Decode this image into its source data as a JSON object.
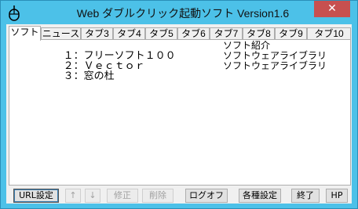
{
  "window": {
    "title": "Web ダブルクリック起動ソフト  Version1.6",
    "close_label": "✕"
  },
  "tabs": [
    {
      "label": "ソフト"
    },
    {
      "label": "ニュース"
    },
    {
      "label": "タブ3"
    },
    {
      "label": "タブ4"
    },
    {
      "label": "タブ5"
    },
    {
      "label": "タブ6"
    },
    {
      "label": "タブ7"
    },
    {
      "label": "タブ8"
    },
    {
      "label": "タブ9"
    },
    {
      "label": "タブ10"
    }
  ],
  "list": {
    "rows": [
      {
        "name": "１：フリーソフト１００",
        "desc": "ソフト紹介"
      },
      {
        "name": "２：Ｖｅｃｔｏｒ",
        "desc": "ソフトウェアライブラリ"
      },
      {
        "name": "３：窓の杜",
        "desc": "ソフトウェアライブラリ"
      }
    ]
  },
  "buttons": {
    "url_settings": "URL設定",
    "up": "↑",
    "down": "↓",
    "edit": "修正",
    "delete": "削除",
    "logoff": "ログオフ",
    "settings": "各種設定",
    "exit": "終了",
    "hp": "HP"
  }
}
